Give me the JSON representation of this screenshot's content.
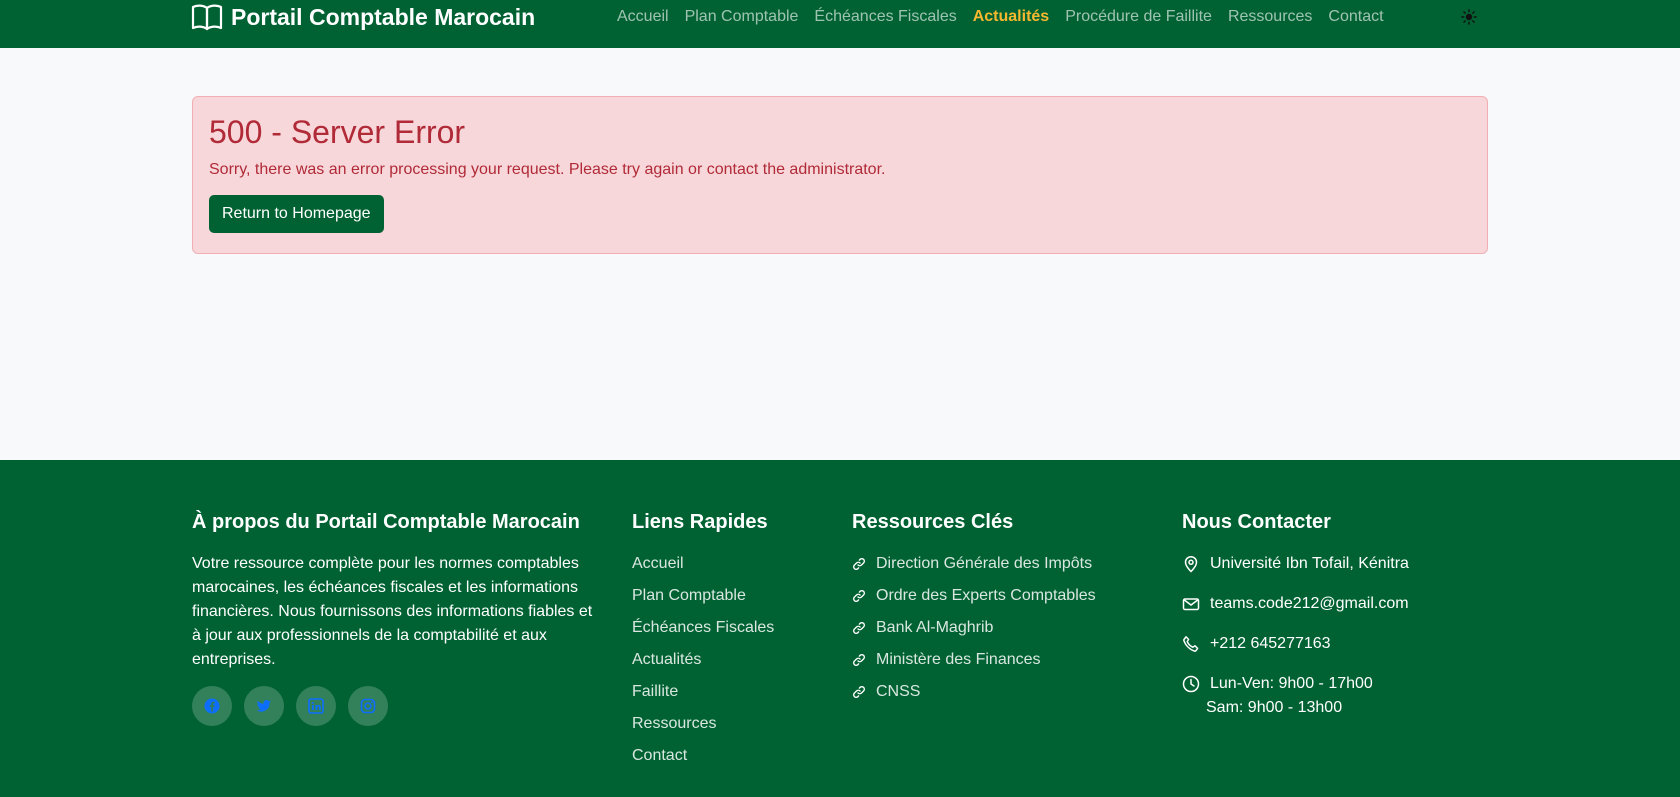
{
  "navbar": {
    "brand": "Portail Comptable Marocain",
    "links": [
      {
        "label": "Accueil",
        "active": false
      },
      {
        "label": "Plan Comptable",
        "active": false
      },
      {
        "label": "Échéances Fiscales",
        "active": false
      },
      {
        "label": "Actualités",
        "active": true
      },
      {
        "label": "Procédure de Faillite",
        "active": false
      },
      {
        "label": "Ressources",
        "active": false
      },
      {
        "label": "Contact",
        "active": false
      }
    ],
    "theme_toggle_icon": "sun-icon"
  },
  "error": {
    "title": "500 - Server Error",
    "message": "Sorry, there was an error processing your request. Please try again or contact the administrator.",
    "button_label": "Return to Homepage"
  },
  "footer": {
    "about": {
      "heading": "À propos du Portail Comptable Marocain",
      "text": "Votre ressource complète pour les normes comptables marocaines, les échéances fiscales et les informations financières. Nous fournissons des informations fiables et à jour aux professionnels de la comptabilité et aux entreprises.",
      "socials": [
        "facebook-icon",
        "twitter-icon",
        "linkedin-icon",
        "instagram-icon"
      ]
    },
    "quick_links": {
      "heading": "Liens Rapides",
      "items": [
        "Accueil",
        "Plan Comptable",
        "Échéances Fiscales",
        "Actualités",
        "Faillite",
        "Ressources",
        "Contact"
      ]
    },
    "resources": {
      "heading": "Ressources Clés",
      "items": [
        "Direction Générale des Impôts",
        "Ordre des Experts Comptables",
        "Bank Al-Maghrib",
        "Ministère des Finances",
        "CNSS"
      ]
    },
    "contact": {
      "heading": "Nous Contacter",
      "address": "Université Ibn Tofail, Kénitra",
      "email": "teams.code212@gmail.com",
      "phone": "+212 645277163",
      "hours_weekday": "Lun-Ven: 9h00 - 17h00",
      "hours_saturday": "Sam: 9h00 - 13h00"
    }
  },
  "colors": {
    "brand_green": "#006233",
    "active_link": "#f5b82e",
    "alert_bg": "#f8d7da",
    "alert_text": "#b02a37",
    "social_icon": "#0d6efd"
  }
}
